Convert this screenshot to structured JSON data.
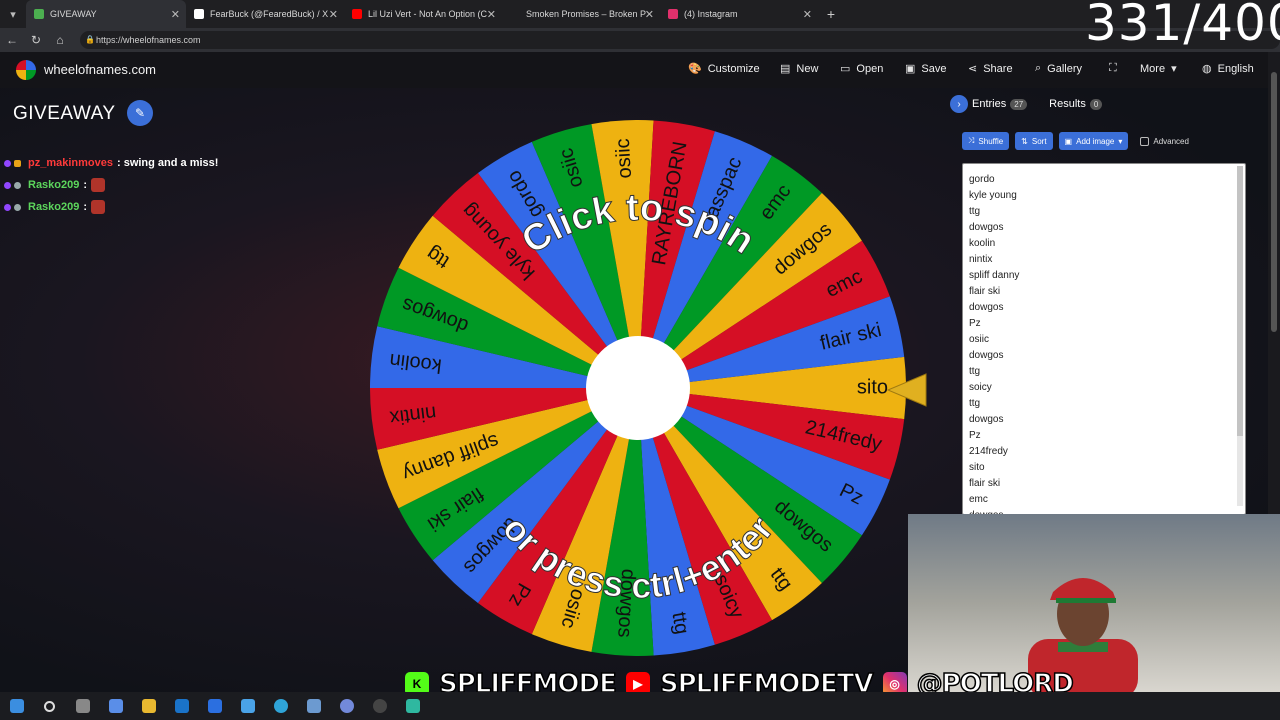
{
  "browser": {
    "tabs": [
      {
        "label": "GIVEAWAY",
        "active": true,
        "color": "#4caf50"
      },
      {
        "label": "FearBuck (@FearedBuck) / X",
        "active": false,
        "color": "#ffffff"
      },
      {
        "label": "Lil Uzi Vert - Not An Option (C",
        "active": false,
        "color": "#ff0000"
      },
      {
        "label": "Smoken Promises – Broken Promi",
        "active": false,
        "color": "#e91e63"
      },
      {
        "label": "(4) Instagram",
        "active": false,
        "color": "#e1306c"
      }
    ],
    "url": "https://wheelofnames.com"
  },
  "site": {
    "name": "wheelofnames.com",
    "nav": [
      "Customize",
      "New",
      "Open",
      "Save",
      "Share",
      "Gallery",
      "Fullscreen",
      "More",
      "English"
    ]
  },
  "page": {
    "title": "GIVEAWAY"
  },
  "chat": [
    {
      "user": "pz_makinmoves",
      "user_color": "#ff3a3a",
      "message": ": swing and a miss!",
      "emote": false
    },
    {
      "user": "Rasko209",
      "user_color": "#5cd65c",
      "message": ":",
      "emote": true
    },
    {
      "user": "Rasko209",
      "user_color": "#5cd65c",
      "message": ":",
      "emote": true
    }
  ],
  "wheel": {
    "center_text_top": "Click to spin",
    "center_text_bottom": "or press ctrl+enter",
    "segments": [
      "sito",
      "214fredy",
      "Pz",
      "dowgos",
      "ttg",
      "soicy",
      "ttg",
      "dowgos",
      "osiic",
      "Pz",
      "dowgos",
      "flair ski",
      "spliff danny",
      "nintix",
      "koolin",
      "dowgos",
      "ttg",
      "kyle young",
      "gordo",
      "osiic",
      "osiic",
      "RAYREBORN",
      "fasspac",
      "emc",
      "dowgos",
      "emc",
      "flair ski"
    ],
    "colors": [
      "#eeb211",
      "#d50f25",
      "#3369e8",
      "#009925"
    ]
  },
  "panel": {
    "tab_entries": "Entries",
    "entries_count": "27",
    "tab_results": "Results",
    "results_count": "0",
    "shuffle": "Shuffle",
    "sort": "Sort",
    "add_image": "Add image",
    "advanced": "Advanced",
    "entries": [
      "gordo",
      "kyle young",
      "ttg",
      "dowgos",
      "koolin",
      "nintix",
      "spliff danny",
      "flair ski",
      "dowgos",
      "Pz",
      "osiic",
      "dowgos",
      "ttg",
      "soicy",
      "ttg",
      "dowgos",
      "Pz",
      "214fredy",
      "sito",
      "flair ski",
      "emc",
      "dowgos"
    ]
  },
  "overlay": {
    "counter": "331/400",
    "social": [
      "SPLIFFMODE",
      "SPLIFFMODETV",
      "@POTLORD"
    ]
  }
}
